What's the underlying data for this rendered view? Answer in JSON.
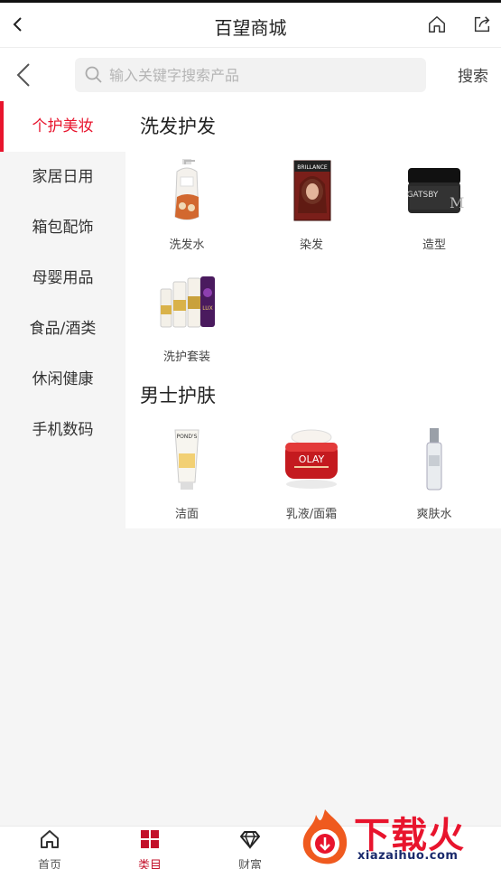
{
  "header": {
    "title": "百望商城"
  },
  "search": {
    "placeholder": "输入关键字搜索产品",
    "button_label": "搜索"
  },
  "sidebar": {
    "items": [
      {
        "label": "个护美妆",
        "active": true
      },
      {
        "label": "家居日用"
      },
      {
        "label": "箱包配饰"
      },
      {
        "label": "母婴用品"
      },
      {
        "label": "食品/酒类"
      },
      {
        "label": "休闲健康"
      },
      {
        "label": "手机数码"
      }
    ]
  },
  "sections": [
    {
      "title": "洗发护发",
      "products": [
        {
          "name": "洗发水",
          "icon": "shampoo-bottle-icon"
        },
        {
          "name": "染发",
          "icon": "hair-dye-box-icon"
        },
        {
          "name": "造型",
          "icon": "styling-wax-jar-icon"
        },
        {
          "name": "洗护套装",
          "icon": "haircare-set-icon"
        }
      ]
    },
    {
      "title": "男士护肤",
      "products": [
        {
          "name": "洁面",
          "icon": "face-wash-tube-icon"
        },
        {
          "name": "乳液/面霜",
          "icon": "cream-jar-icon"
        },
        {
          "name": "爽肤水",
          "icon": "toner-bottle-icon"
        }
      ]
    }
  ],
  "product_text": {
    "dye_brand": "BRILLANCE",
    "wax_brand": "GATSBY",
    "wax_mark": "M",
    "facewash_brand": "POND'S",
    "cream_brand": "OLAY",
    "set_brand": "LUX"
  },
  "bottom_nav": [
    {
      "label": "首页",
      "icon": "home-icon"
    },
    {
      "label": "类目",
      "icon": "category-grid-icon",
      "active": true
    },
    {
      "label": "财富",
      "icon": "diamond-icon"
    }
  ],
  "watermark": {
    "text": "下载火",
    "sub": "xiazaihuo.com"
  },
  "colors": {
    "accent": "#e8142d",
    "sidebar_bg": "#f5f5f5",
    "nav_active": "#c3102a"
  }
}
